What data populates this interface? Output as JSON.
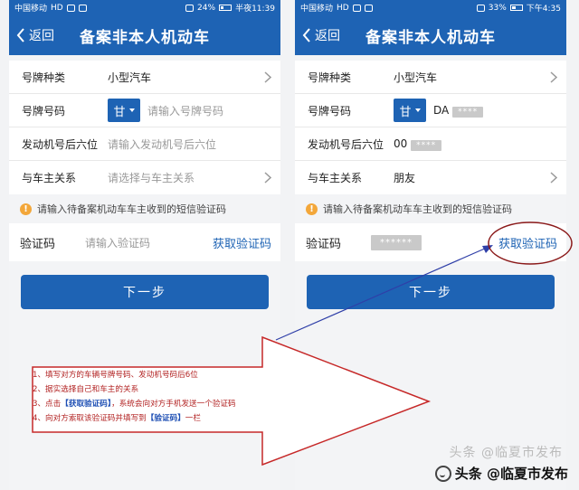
{
  "left_phone": {
    "status": {
      "carrier": "中国移动",
      "network": "HD",
      "battery": "24%",
      "time": "半夜11:39"
    },
    "nav": {
      "back": "返回",
      "title": "备案非本人机动车"
    },
    "rows": {
      "plate_type_label": "号牌种类",
      "plate_type_value": "小型汽车",
      "plate_no_label": "号牌号码",
      "province": "甘",
      "plate_no_placeholder": "请输入号牌号码",
      "engine_label": "发动机号后六位",
      "engine_placeholder": "请输入发动机号后六位",
      "relation_label": "与车主关系",
      "relation_placeholder": "请选择与车主关系"
    },
    "notice": "请输入待备案机动车车主收到的短信验证码",
    "code": {
      "label": "验证码",
      "placeholder": "请输入验证码",
      "get_code": "获取验证码"
    },
    "next": "下一步"
  },
  "right_phone": {
    "status": {
      "carrier": "中国移动",
      "network": "HD",
      "battery": "33%",
      "time": "下午4:35"
    },
    "nav": {
      "back": "返回",
      "title": "备案非本人机动车"
    },
    "rows": {
      "plate_type_label": "号牌种类",
      "plate_type_value": "小型汽车",
      "plate_no_label": "号牌号码",
      "province": "甘",
      "plate_no_value": "DA",
      "plate_no_mask": "****",
      "engine_label": "发动机号后六位",
      "engine_value": "00",
      "engine_mask": "****",
      "relation_label": "与车主关系",
      "relation_value": "朋友"
    },
    "notice": "请输入待备案机动车车主收到的短信验证码",
    "code": {
      "label": "验证码",
      "mask": "******",
      "get_code": "获取验证码"
    },
    "next": "下一步"
  },
  "instructions": {
    "line1": "1、填写对方的车辆号牌号码、发动机号码后6位",
    "line2": "2、据实选择自己和车主的关系",
    "line3_pre": "3、点击",
    "line3_hl": "【获取验证码】",
    "line3_post": "，系统会向对方手机发送一个验证码",
    "line4_pre": "4、向对方索取该验证码并填写到",
    "line4_hl": "【验证码】",
    "line4_post": "一栏"
  },
  "watermark": {
    "text": "头条 @临夏市发布",
    "shadow": "头条 @临夏市发布"
  },
  "colors": {
    "brand_blue": "#1e63b4",
    "annotation_red": "#b22222",
    "arrow_blue": "#2f3fa8"
  }
}
